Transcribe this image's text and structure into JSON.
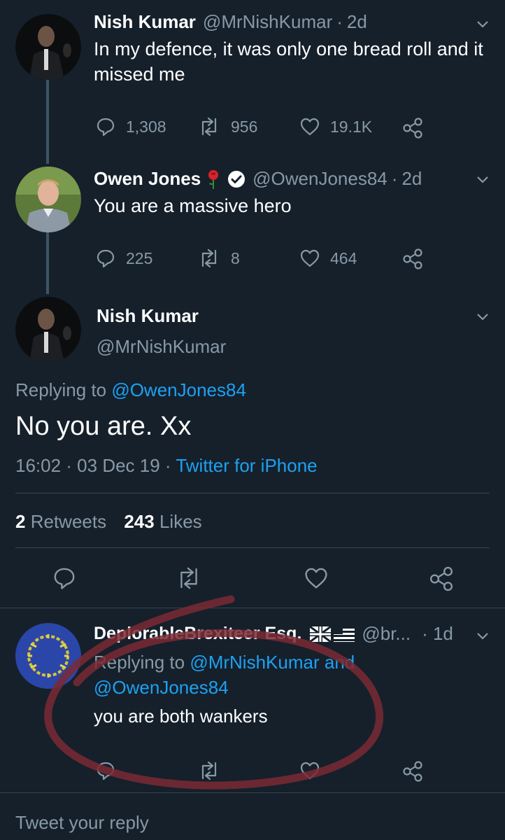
{
  "tweets": [
    {
      "name": "Nish Kumar",
      "handle": "@MrNishKumar",
      "time": "2d",
      "text": "In my defence, it was only one bread roll and it missed me",
      "replies": "1,308",
      "retweets": "956",
      "likes": "19.1K"
    },
    {
      "name": "Owen Jones",
      "handle": "@OwenJones84",
      "time": "2d",
      "text": "You are a massive hero",
      "replies": "225",
      "retweets": "8",
      "likes": "464"
    }
  ],
  "focused": {
    "name": "Nish Kumar",
    "handle": "@MrNishKumar",
    "replying_label": "Replying to",
    "replying_handle": "@OwenJones84",
    "text": "No you are. Xx",
    "timestamp": "16:02 · 03 Dec 19 · ",
    "source": "Twitter for iPhone",
    "retweet_count": "2",
    "retweet_label": "Retweets",
    "like_count": "243",
    "like_label": "Likes"
  },
  "reply": {
    "name": "DeplorableBrexiteer Esq.",
    "handle": "@br...",
    "time": "· 1d",
    "replying_label": "Replying to",
    "replying_handle1": "@MrNishKumar",
    "and_label": "and",
    "replying_handle2": "@OwenJones84",
    "text": "you are both wankers"
  },
  "composer": {
    "placeholder": "Tweet your reply"
  },
  "colors": {
    "background": "#15202b",
    "accent": "#1da1f2",
    "muted": "#8899a6",
    "circle_annotation": "#7a2a34"
  }
}
